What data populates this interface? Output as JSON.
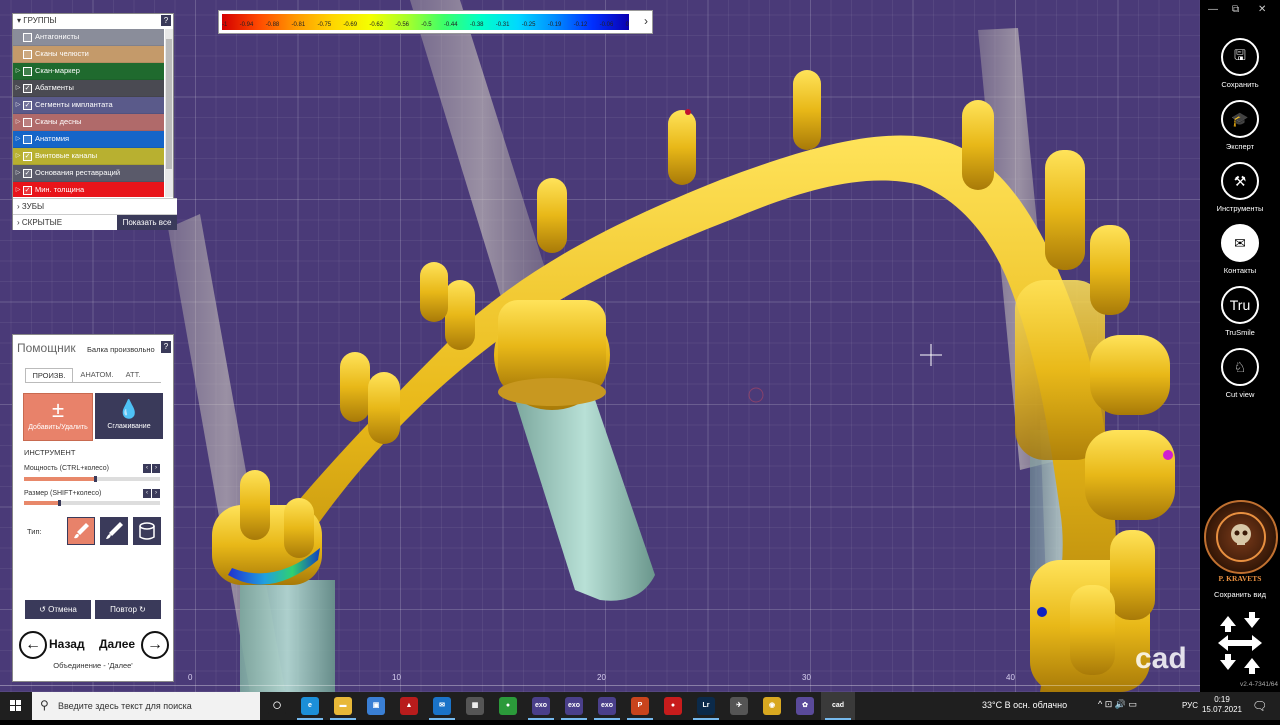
{
  "viewport": {
    "ruler_labels": [
      "0",
      "10",
      "20",
      "30",
      "40"
    ],
    "watermark": "cad"
  },
  "color_scale": {
    "labels": [
      "-1",
      "-0.94",
      "-0.88",
      "-0.81",
      "-0.75",
      "-0.69",
      "-0.62",
      "-0.56",
      "-0.5",
      "-0.44",
      "-0.38",
      "-0.31",
      "-0.25",
      "-0.19",
      "-0.12",
      "-0.06",
      "0"
    ],
    "expand_arrow": "›"
  },
  "groups": {
    "header": "ГРУППЫ",
    "help": "?",
    "items": [
      {
        "label": "Антагонисты",
        "checked": false,
        "expandable": false,
        "color": "#8a8d9a"
      },
      {
        "label": "Сканы челюсти",
        "checked": false,
        "expandable": false,
        "color": "#c49a6a"
      },
      {
        "label": "Скан-маркер",
        "checked": false,
        "expandable": true,
        "color": "#1f6a2e"
      },
      {
        "label": "Абатменты",
        "checked": true,
        "expandable": true,
        "color": "#4a4a52"
      },
      {
        "label": "Сегменты имплантата",
        "checked": true,
        "expandable": true,
        "color": "#5a5a8a"
      },
      {
        "label": "Сканы десны",
        "checked": false,
        "expandable": true,
        "color": "#b06a6a"
      },
      {
        "label": "Анатомия",
        "checked": false,
        "expandable": true,
        "color": "#1565c8"
      },
      {
        "label": "Винтовые каналы",
        "checked": true,
        "expandable": true,
        "color": "#b8b030"
      },
      {
        "label": "Основания реставраций",
        "checked": true,
        "expandable": true,
        "color": "#5a5a6a"
      },
      {
        "label": "Мин. толщина",
        "checked": true,
        "expandable": true,
        "color": "#e8141a"
      }
    ],
    "teeth": "ЗУБЫ",
    "hidden": "СКРЫТЫЕ",
    "show_all": "Показать все",
    "check_mark": "✓",
    "expand_mark": "▷",
    "section_mark": "›"
  },
  "assistant": {
    "title": "Помощник",
    "subtitle": "Балка произвольно",
    "help": "?",
    "tabs": [
      "ПРОИЗВ.",
      "АНАТОМ.",
      "АТТ."
    ],
    "add_remove": "Добавить/Удалить",
    "add_remove_icon": "±",
    "smoothing": "Сглаживание",
    "smoothing_icon": "💧",
    "instrument": "ИНСТРУМЕНТ",
    "power": "Мощность (CTRL+колесо)",
    "power_value": 0.52,
    "size": "Размер (SHIFT+колесо)",
    "size_value": 0.26,
    "type": "Тип:",
    "undo": "Отмена",
    "redo": "Повтор",
    "undo_icon": "↺",
    "redo_icon": "↻",
    "back": "Назад",
    "next": "Далее",
    "back_icon": "←",
    "next_icon": "→",
    "footer": "Объединение - 'Далее'",
    "spin_left": "‹",
    "spin_right": "›"
  },
  "sidebar": {
    "window_controls": [
      "—",
      "⧉",
      "✕"
    ],
    "buttons": [
      {
        "label": "Сохранить",
        "icon": "save-icon",
        "glyph": "🖫"
      },
      {
        "label": "Эксперт",
        "icon": "graduation-cap-icon",
        "glyph": "🎓"
      },
      {
        "label": "Инструменты",
        "icon": "tools-icon",
        "glyph": "⚒"
      },
      {
        "label": "Контакты",
        "icon": "contacts-icon",
        "glyph": "✉"
      },
      {
        "label": "TruSmile",
        "icon": "trusmile-icon",
        "glyph": "Tru"
      },
      {
        "label": "Cut view",
        "icon": "tooth-icon",
        "glyph": "♘"
      }
    ],
    "badge_name": "P. KRAVETS",
    "save_view": "Сохранить вид",
    "version": "v2.4-7341/64"
  },
  "taskbar": {
    "search_placeholder": "Введите здесь текст для поиска",
    "search_glyph": "⚲",
    "apps": [
      {
        "name": "task-view",
        "glyph": "◯",
        "color": "#1f1f1f"
      },
      {
        "name": "edge",
        "glyph": "e",
        "color": "#1c8fd8"
      },
      {
        "name": "explorer",
        "glyph": "▬",
        "color": "#e8b838"
      },
      {
        "name": "store",
        "glyph": "▣",
        "color": "#3a7fd4"
      },
      {
        "name": "app-red",
        "glyph": "▲",
        "color": "#b81c1c"
      },
      {
        "name": "mail",
        "glyph": "✉",
        "color": "#1a73c8"
      },
      {
        "name": "app-grey",
        "glyph": "▦",
        "color": "#555"
      },
      {
        "name": "chrome",
        "glyph": "●",
        "color": "#2b9a3a"
      },
      {
        "name": "exo1",
        "glyph": "exo",
        "color": "#4a3f8a"
      },
      {
        "name": "exo2",
        "glyph": "exo",
        "color": "#4a3f8a"
      },
      {
        "name": "exo3",
        "glyph": "exo",
        "color": "#4a3f8a"
      },
      {
        "name": "powerpoint",
        "glyph": "P",
        "color": "#c8441c"
      },
      {
        "name": "recorder",
        "glyph": "●",
        "color": "#c81c1c"
      },
      {
        "name": "lightroom",
        "glyph": "Lr",
        "color": "#0b2a4a"
      },
      {
        "name": "app-bird",
        "glyph": "✈",
        "color": "#555"
      },
      {
        "name": "app-yellow",
        "glyph": "◉",
        "color": "#d8a820"
      },
      {
        "name": "app-purple",
        "glyph": "✿",
        "color": "#5a4a9a"
      },
      {
        "name": "cad",
        "glyph": "cad",
        "color": "#3a3a3a"
      }
    ],
    "weather": "33°C  В осн. облачно",
    "tray": "^  ⊡  🔊  ▭",
    "lang": "РУС",
    "time": "0:19",
    "date": "15.07.2021",
    "notif": "🗨"
  }
}
